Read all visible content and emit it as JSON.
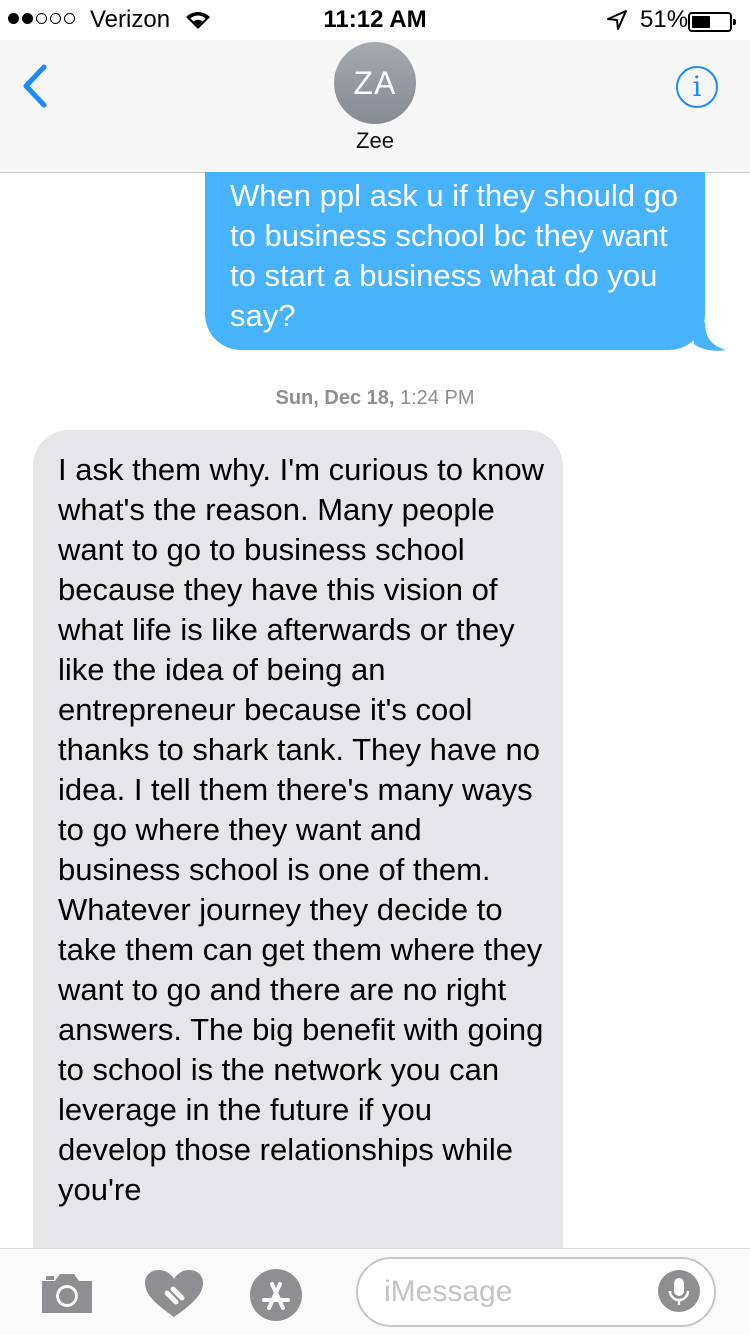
{
  "status_bar": {
    "carrier": "Verizon",
    "time": "11:12 AM",
    "battery_percent": "51%",
    "battery_level": 0.51,
    "signal_bars_filled": 2,
    "signal_bars_total": 5
  },
  "header": {
    "avatar_initials": "ZA",
    "contact_name": "Zee",
    "info_glyph": "i",
    "accent_color": "#1a8cff",
    "back_icon": "chevron-left-icon"
  },
  "messages": {
    "outgoing_text": "When ppl ask u if they should go to business school bc they want to start a business what do you say?",
    "outgoing_color": "#46b3fc",
    "timestamp_day": "Sun, Dec 18,",
    "timestamp_time": "1:24 PM",
    "incoming_text": "I ask them why. I'm curious to know what's the reason. Many people want to go to business school because they have this vision of what life is like afterwards or they like the idea of being an entrepreneur because it's cool thanks to shark tank. They have no idea. I tell them there's many ways to go where they want and business school is one of them. Whatever journey they decide to take them can get them where they want to go and there are no right answers. The big benefit with going to school is the network you can leverage in the future if you develop those relationships while you're",
    "incoming_color": "#e5e5ea"
  },
  "input_bar": {
    "placeholder": "iMessage",
    "icons": [
      "camera-icon",
      "digital-touch-icon",
      "app-store-icon",
      "microphone-icon"
    ]
  }
}
